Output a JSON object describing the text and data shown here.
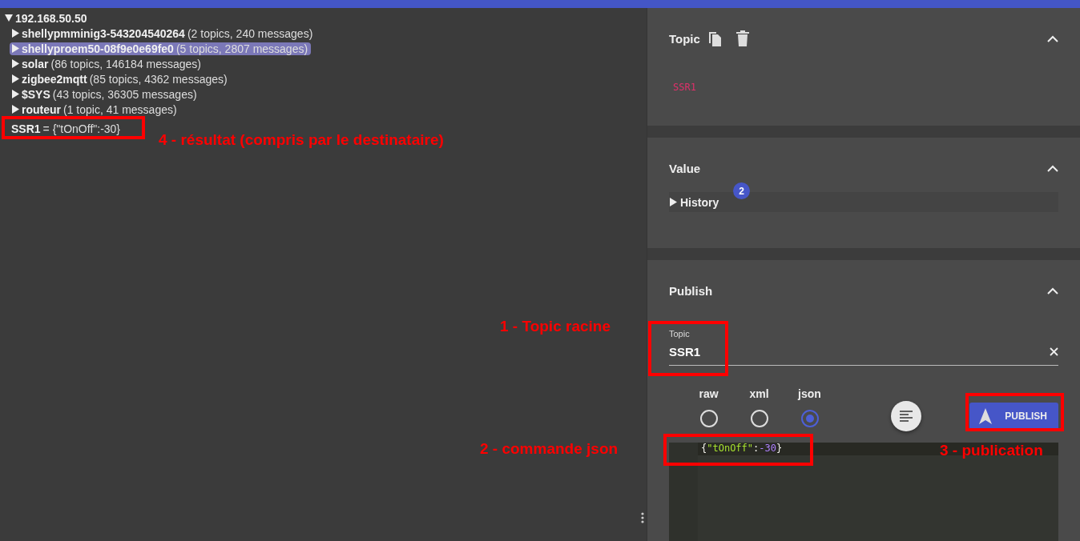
{
  "tree": {
    "label": "192.168.50.50",
    "expanded": true,
    "children": [
      {
        "name": "shellypmminig3-543204540264",
        "detail": "(2 topics, 240 messages)",
        "selected": false,
        "expanded": false
      },
      {
        "name": "shellyproem50-08f9e0e69fe0",
        "detail": "(5 topics, 2807 messages)",
        "selected": true,
        "expanded": false
      },
      {
        "name": "solar",
        "detail": "(86 topics, 146184 messages)",
        "selected": false,
        "expanded": false
      },
      {
        "name": "zigbee2mqtt",
        "detail": "(85 topics, 4362 messages)",
        "selected": false,
        "expanded": false
      },
      {
        "name": "$SYS",
        "detail": "(43 topics, 36305 messages)",
        "selected": false,
        "expanded": false
      },
      {
        "name": "routeur",
        "detail": "(1 topic, 41 messages)",
        "selected": false,
        "expanded": false
      }
    ],
    "message": {
      "topic": "SSR1",
      "value": "= {\"tOnOff\":-30}"
    }
  },
  "topic_panel": {
    "title": "Topic",
    "expanded": true,
    "value": "SSR1"
  },
  "value_panel": {
    "title": "Value",
    "expanded": true,
    "history": {
      "label": "History",
      "badge": "2"
    }
  },
  "publish_panel": {
    "title": "Publish",
    "expanded": true,
    "topic_field": {
      "label": "Topic",
      "value": "SSR1"
    },
    "formats": [
      {
        "label": "raw",
        "selected": false
      },
      {
        "label": "xml",
        "selected": false
      },
      {
        "label": "json",
        "selected": true
      }
    ],
    "button": "PUBLISH",
    "editor_tokens": [
      {
        "kind": "punct",
        "text": "{"
      },
      {
        "kind": "string",
        "text": "\"tOnOff\""
      },
      {
        "kind": "punct",
        "text": ":"
      },
      {
        "kind": "number",
        "text": "-30"
      },
      {
        "kind": "punct",
        "text": "}"
      }
    ]
  },
  "annotations": [
    {
      "text": "4 - résultat (compris par le destinataire)"
    },
    {
      "text": "1 - Topic racine"
    },
    {
      "text": "2 - commande json"
    },
    {
      "text": "3 - publication"
    }
  ]
}
